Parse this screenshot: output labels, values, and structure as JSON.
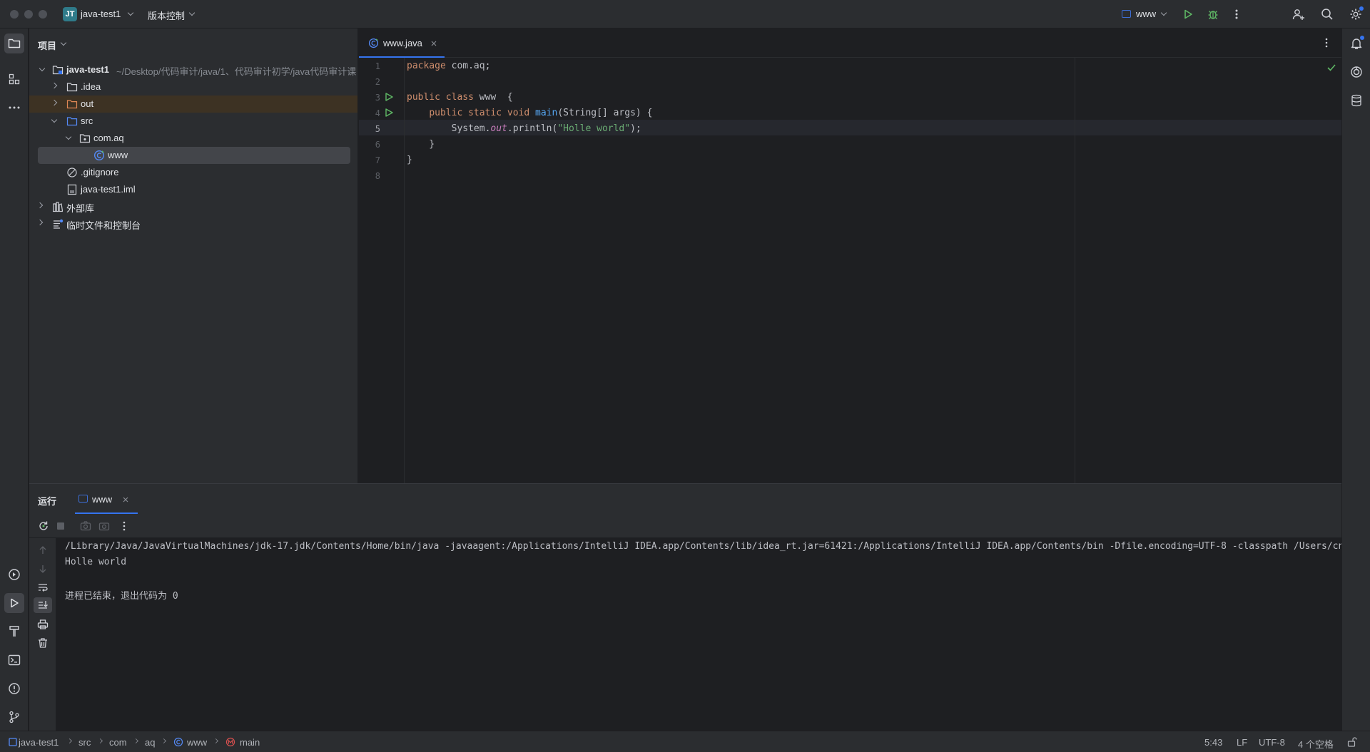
{
  "titlebar": {
    "project_badge": "JT",
    "project_name": "java-test1",
    "vcs_label": "版本控制",
    "run_config": "www",
    "icons": [
      "run-icon",
      "debug-icon",
      "more-icon",
      "add-user-icon",
      "search-icon",
      "settings-icon"
    ]
  },
  "left_strip": {
    "icons": [
      "project-folder-icon",
      "structure-icon",
      "more-tools-icon",
      "services-icon",
      "run-icon",
      "build-icon",
      "terminal-icon",
      "problems-icon",
      "git-icon"
    ]
  },
  "right_strip": {
    "icons": [
      "notifications-icon",
      "ai-assistant-icon",
      "database-icon"
    ]
  },
  "project_panel": {
    "title": "项目",
    "tree": [
      {
        "label": "java-test1",
        "sub": "~/Desktop/代码审计/java/1、代码审计初学/java代码审计课",
        "depth": 0,
        "expanded": true,
        "icon": "module-folder-icon",
        "bold": true
      },
      {
        "label": ".idea",
        "depth": 1,
        "expanded": false,
        "icon": "folder-icon"
      },
      {
        "label": "out",
        "depth": 1,
        "expanded": false,
        "icon": "excluded-folder-icon",
        "highlight": true
      },
      {
        "label": "src",
        "depth": 1,
        "expanded": true,
        "icon": "source-folder-icon"
      },
      {
        "label": "com.aq",
        "depth": 2,
        "expanded": true,
        "icon": "package-icon"
      },
      {
        "label": "www",
        "depth": 3,
        "icon": "java-class-icon",
        "selected": true
      },
      {
        "label": ".gitignore",
        "depth": 1,
        "icon": "ignore-file-icon"
      },
      {
        "label": "java-test1.iml",
        "depth": 1,
        "icon": "iml-file-icon"
      },
      {
        "label": "外部库",
        "depth": 0,
        "expanded": false,
        "icon": "library-icon"
      },
      {
        "label": "临时文件和控制台",
        "depth": 0,
        "expanded": false,
        "icon": "scratches-icon"
      }
    ]
  },
  "editor": {
    "tab_label": "www.java",
    "current_line": 5,
    "line_numbers": [
      "1",
      "2",
      "3",
      "4",
      "5",
      "6",
      "7",
      "8"
    ],
    "code": {
      "l1_kw": "package",
      "l1_rest": " com.aq;",
      "l3_kw": "public class",
      "l3_rest": " www  {",
      "l4_indent": "    ",
      "l4_kw": "public static void",
      "l4_fn": "main",
      "l4_rest": "(String[] args) {",
      "l5_a": "        System.",
      "l5_field": "out",
      "l5_b": ".println(",
      "l5_str": "\"Holle world\"",
      "l5_c": ");",
      "l6": "    }",
      "l7": "}"
    }
  },
  "run_panel": {
    "title": "运行",
    "tab_label": "www",
    "console": [
      "/Library/Java/JavaVirtualMachines/jdk-17.jdk/Contents/Home/bin/java -javaagent:/Applications/IntelliJ IDEA.app/Contents/lib/idea_rt.jar=61421:/Applications/IntelliJ IDEA.app/Contents/bin -Dfile.encoding=UTF-8 -classpath /Users/cnd",
      "Holle world",
      "",
      "进程已结束，退出代码为 0"
    ]
  },
  "statusbar": {
    "breadcrumbs": [
      "java-test1",
      "src",
      "com",
      "aq",
      "www",
      "main"
    ],
    "position": "5:43",
    "line_ending": "LF",
    "encoding": "UTF-8",
    "indent": "4 个空格"
  },
  "colors": {
    "accent": "#3574f0",
    "run_green": "#5fb865",
    "background": "#1e1f22",
    "panel": "#2b2d30"
  }
}
